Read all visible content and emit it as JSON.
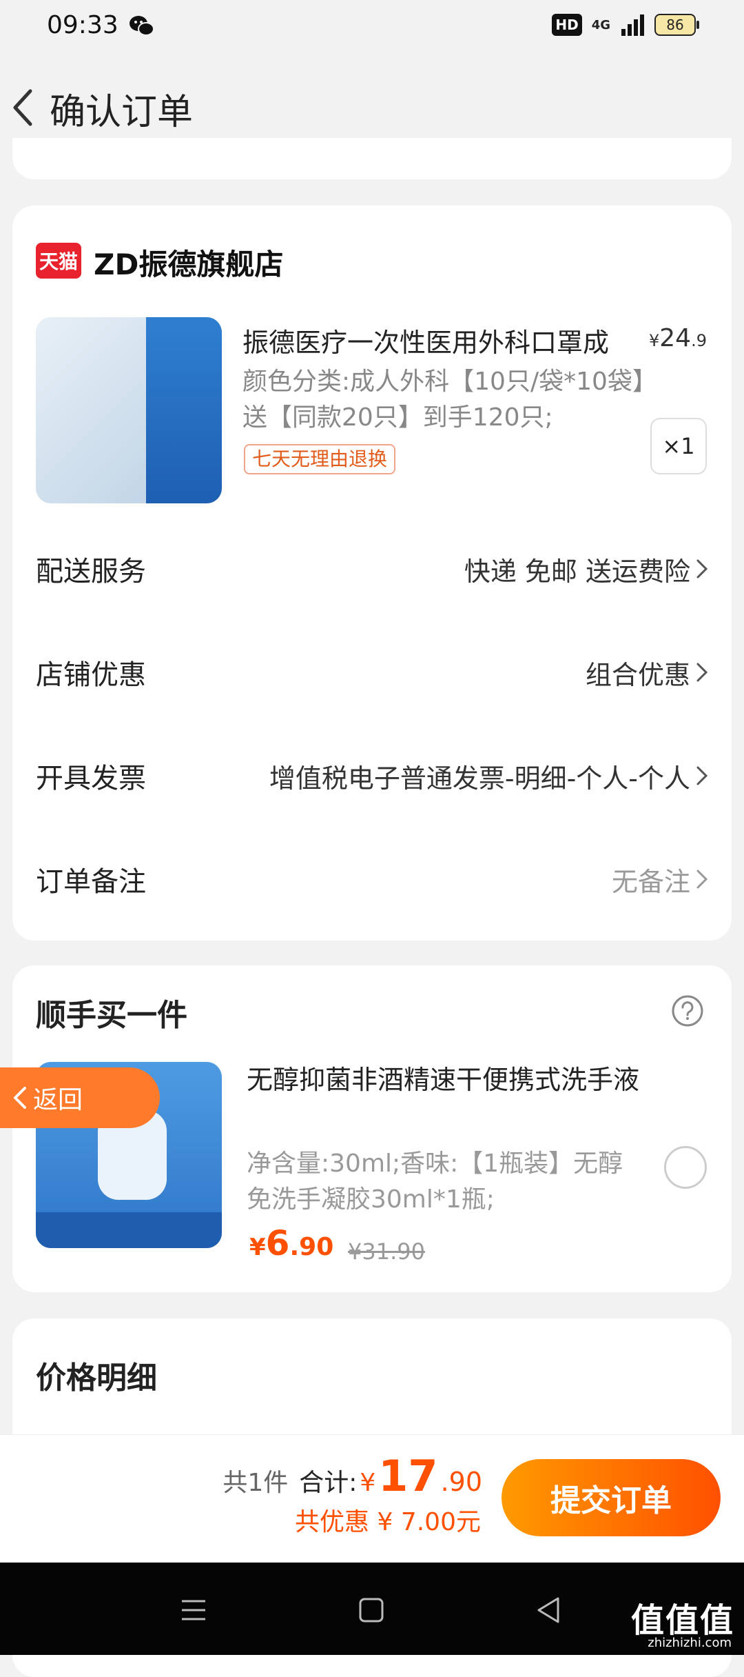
{
  "status_bar": {
    "time": "09:33",
    "network": "4G",
    "hd_badge": "HD",
    "battery": "86"
  },
  "header": {
    "title": "确认订单"
  },
  "store": {
    "badge": "天猫",
    "name": "ZD振德旗舰店"
  },
  "product": {
    "title": "振德医疗一次性医用外科口罩成",
    "price_symbol": "¥",
    "price_int": "24",
    "price_dec": ".9",
    "spec": "颜色分类:成人外科【10只/袋*10袋】送【同款20只】到手120只;",
    "return_tag": "七天无理由退换",
    "quantity": "×1"
  },
  "rows": [
    {
      "label": "配送服务",
      "value": "快递 免邮 送运费险"
    },
    {
      "label": "店铺优惠",
      "value": "组合优惠"
    },
    {
      "label": "开具发票",
      "value": "增值税电子普通发票-明细-个人-个人"
    },
    {
      "label": "订单备注",
      "value": "无备注"
    }
  ],
  "addon": {
    "title": "顺手买一件",
    "name": "无醇抑菌非酒精速干便携式洗手液",
    "spec": "净含量:30ml;香味:【1瓶装】无醇免洗手凝胶30ml*1瓶;",
    "price_symbol": "¥",
    "price_int": "6",
    "price_dec": ".90",
    "original_price": "¥31.90"
  },
  "floating_back": {
    "label": "返回"
  },
  "price_detail": {
    "title": "价格明细"
  },
  "bottom_bar": {
    "count": "共1件",
    "total_label": "合计:",
    "total_symbol": "¥",
    "total_int": "17",
    "total_dec": ".90",
    "saving": "共优惠 ¥ 7.00元",
    "submit": "提交订单"
  },
  "watermark": {
    "text": "值值值",
    "sub": "zhizhizhi.com"
  },
  "colors": {
    "accent": "#ff5000",
    "tmall_red": "#e8232d",
    "background": "#f2f2f2"
  }
}
